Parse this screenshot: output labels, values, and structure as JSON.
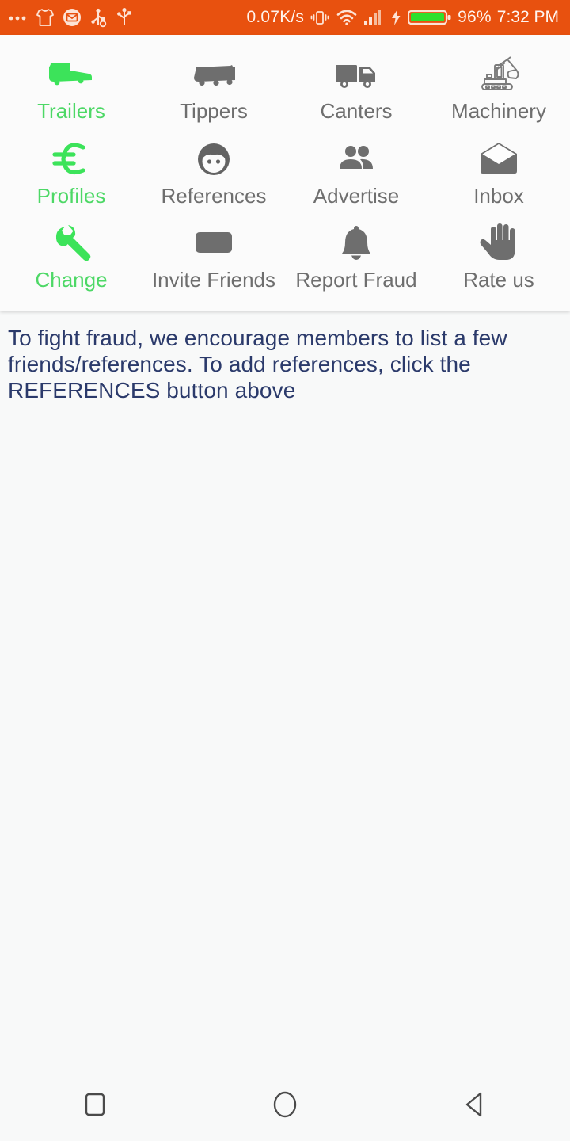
{
  "statusbar": {
    "left_icons": [
      "more-dots-icon",
      "shirt-icon",
      "email-circle-icon",
      "usb-debug-icon",
      "usb-icon"
    ],
    "network_speed": "0.07K/s",
    "right_icons": [
      "vibrate-icon",
      "wifi-icon",
      "signal-bars-icon",
      "charging-bolt-icon",
      "battery-icon"
    ],
    "battery_percent": "96%",
    "time": "7:32 PM",
    "background_color": "#e8510f",
    "battery_color": "#2ee02e"
  },
  "menu": {
    "accent_color": "#4dd866",
    "default_color": "#6e6e6e",
    "rows": [
      [
        {
          "label": "Trailers",
          "icon": "trailer-icon",
          "accent": true
        },
        {
          "label": "Tippers",
          "icon": "tipper-truck-icon",
          "accent": false
        },
        {
          "label": "Canters",
          "icon": "box-truck-icon",
          "accent": false
        },
        {
          "label": "Machinery",
          "icon": "excavator-icon",
          "accent": false
        }
      ],
      [
        {
          "label": "Profiles",
          "icon": "euro-icon",
          "accent": true
        },
        {
          "label": "References",
          "icon": "person-face-icon",
          "accent": false
        },
        {
          "label": "Advertise",
          "icon": "people-group-icon",
          "accent": false
        },
        {
          "label": "Inbox",
          "icon": "open-envelope-icon",
          "accent": false
        }
      ],
      [
        {
          "label": "Change",
          "icon": "wrench-icon",
          "accent": true
        },
        {
          "label": "Invite Friends",
          "icon": "rounded-rect-icon",
          "accent": false
        },
        {
          "label": "Report Fraud",
          "icon": "bell-icon",
          "accent": false
        },
        {
          "label": "Rate us",
          "icon": "hand-palm-icon",
          "accent": false
        }
      ]
    ]
  },
  "notice": {
    "text": "To fight fraud, we encourage members to list a few friends/references. To add references, click the REFERENCES button above",
    "color": "#2b3a6b"
  },
  "navbar": {
    "buttons": [
      {
        "name": "recents-button",
        "icon": "square-icon"
      },
      {
        "name": "home-button",
        "icon": "circle-icon"
      },
      {
        "name": "back-button",
        "icon": "triangle-left-icon"
      }
    ]
  }
}
